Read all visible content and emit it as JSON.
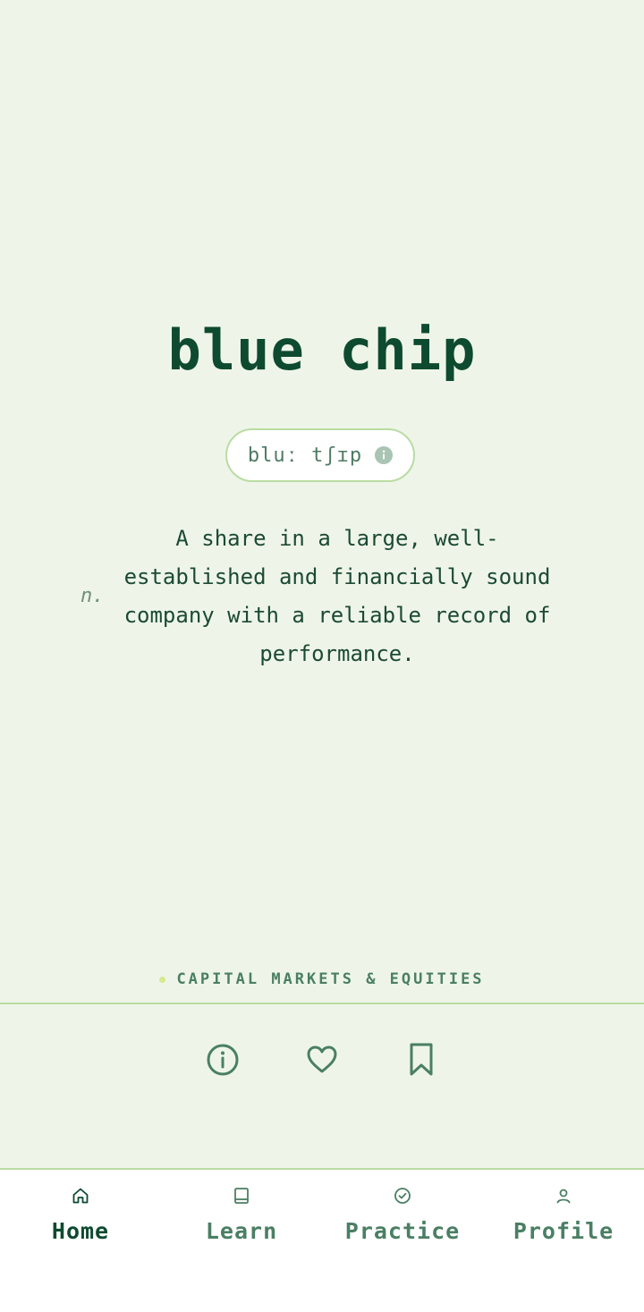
{
  "card": {
    "term": "blue chip",
    "pronunciation": "bluː tʃɪp",
    "part_of_speech": "n.",
    "definition": "A share in a large, well-established and financially sound company with a reliable record of performance.",
    "category": "CAPITAL MARKETS & EQUITIES"
  },
  "actions": [
    {
      "icon": "info-icon"
    },
    {
      "icon": "heart-icon"
    },
    {
      "icon": "bookmark-icon"
    }
  ],
  "nav": {
    "items": [
      {
        "label": "Home",
        "icon": "home-icon",
        "active": true
      },
      {
        "label": "Learn",
        "icon": "book-icon",
        "active": false
      },
      {
        "label": "Practice",
        "icon": "check-circle-icon",
        "active": false
      },
      {
        "label": "Profile",
        "icon": "user-icon",
        "active": false
      }
    ]
  },
  "colors": {
    "background": "#eef5e8",
    "primary": "#0e4a30",
    "accent": "#4a7f63",
    "border": "#b9dca2"
  }
}
